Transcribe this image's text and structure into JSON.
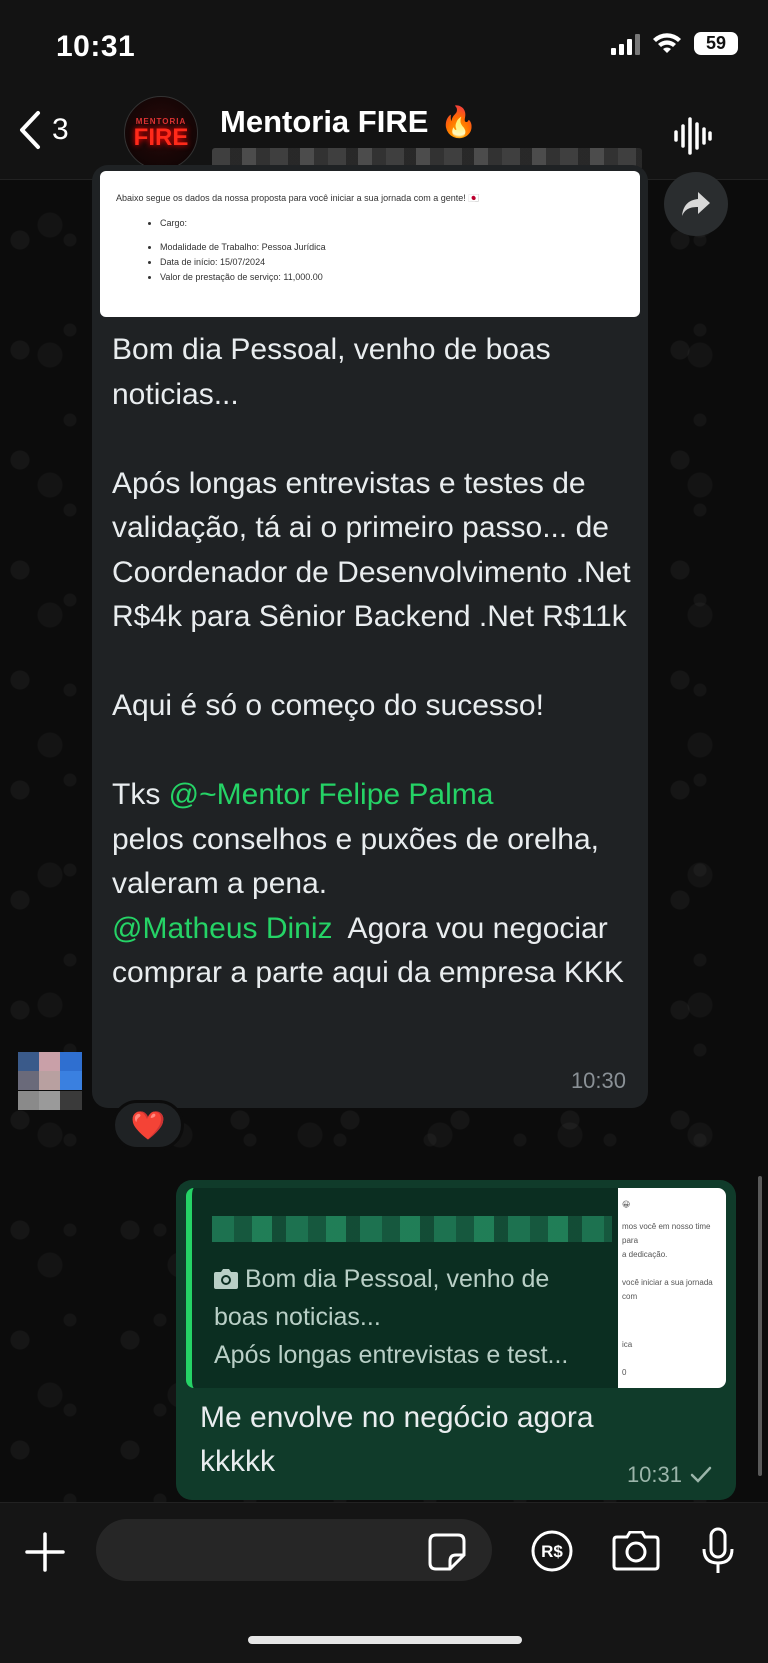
{
  "status_bar": {
    "time": "10:31",
    "battery": "59"
  },
  "header": {
    "back_count": "3",
    "chat_name": "Mentoria FIRE",
    "title_emoji": "🔥",
    "avatar_small_text": "MENTORIA",
    "avatar_big_text": "FIRE"
  },
  "incoming": {
    "attachment": {
      "intro": "Abaixo segue os dados da nossa proposta para você iniciar a sua jornada com a gente! 🇯🇵",
      "items": [
        "Cargo:",
        "Modalidade de Trabalho: Pessoa Jurídica",
        "Data de início: 15/07/2024",
        "Valor de prestação de serviço: 11,000.00"
      ]
    },
    "text_part1": "Bom dia Pessoal, venho de boas noticias...\n\nApós longas entrevistas e testes de validação, tá ai o primeiro passo... de Coordenador de Desenvolvimento .Net R$4k para Sênior Backend .Net R$11k\n\nAqui é só o começo do sucesso!\n\nTks ",
    "mention1": "@~Mentor Felipe Palma",
    "text_part2": "\npelos conselhos e puxões de orelha, valeram a pena.\n",
    "mention2": "@Matheus Diniz",
    "text_part3": "  Agora vou negociar comprar a parte aqui da empresa KKK",
    "time": "10:30",
    "reaction": "❤️"
  },
  "outgoing": {
    "quote_line1": "Bom dia Pessoal, venho de",
    "quote_line2": "boas noticias...",
    "quote_line3": "Após longas entrevistas e test...",
    "thumb_lines": [
      "😀",
      "mos você em nosso time para",
      "a dedicação.",
      "você iniciar a sua jornada com",
      "ica",
      "0"
    ],
    "text": "Me envolve no negócio agora\nkkkkk",
    "time": "10:31"
  },
  "composer": {
    "placeholder": "",
    "pay_label": "R$"
  },
  "colors": {
    "mention": "#25d366",
    "incoming_bubble": "#1f2224",
    "outgoing_bubble": "#103b2a"
  }
}
